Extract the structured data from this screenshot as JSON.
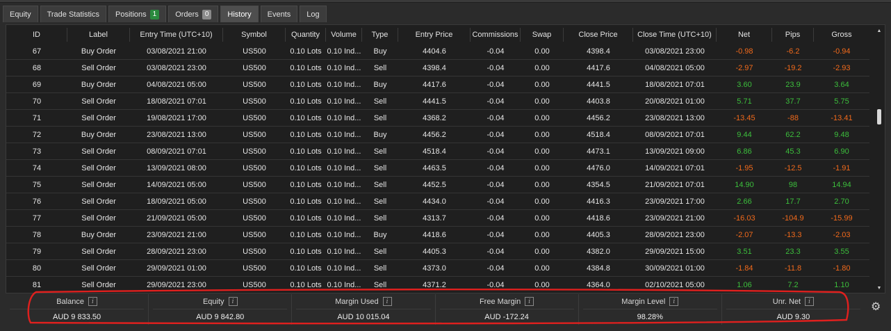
{
  "tabs": [
    {
      "label": "Equity"
    },
    {
      "label": "Trade Statistics"
    },
    {
      "label": "Positions",
      "badge": "1"
    },
    {
      "label": "Orders",
      "badge": "0"
    },
    {
      "label": "History",
      "active": true
    },
    {
      "label": "Events"
    },
    {
      "label": "Log"
    }
  ],
  "table": {
    "columns": [
      "ID",
      "Label",
      "Entry Time (UTC+10)",
      "Symbol",
      "Quantity",
      "Volume",
      "Type",
      "Entry Price",
      "Commissions",
      "Swap",
      "Close Price",
      "Close Time (UTC+10)",
      "Net",
      "Pips",
      "Gross"
    ],
    "rows": [
      [
        "67",
        "Buy Order",
        "03/08/2021 21:00",
        "US500",
        "0.10 Lots",
        "0.10 Ind...",
        "Buy",
        "4404.6",
        "-0.04",
        "0.00",
        "4398.4",
        "03/08/2021 23:00",
        "-0.98",
        "-6.2",
        "-0.94"
      ],
      [
        "68",
        "Sell Order",
        "03/08/2021 23:00",
        "US500",
        "0.10 Lots",
        "0.10 Ind...",
        "Sell",
        "4398.4",
        "-0.04",
        "0.00",
        "4417.6",
        "04/08/2021 05:00",
        "-2.97",
        "-19.2",
        "-2.93"
      ],
      [
        "69",
        "Buy Order",
        "04/08/2021 05:00",
        "US500",
        "0.10 Lots",
        "0.10 Ind...",
        "Buy",
        "4417.6",
        "-0.04",
        "0.00",
        "4441.5",
        "18/08/2021 07:01",
        "3.60",
        "23.9",
        "3.64"
      ],
      [
        "70",
        "Sell Order",
        "18/08/2021 07:01",
        "US500",
        "0.10 Lots",
        "0.10 Ind...",
        "Sell",
        "4441.5",
        "-0.04",
        "0.00",
        "4403.8",
        "20/08/2021 01:00",
        "5.71",
        "37.7",
        "5.75"
      ],
      [
        "71",
        "Sell Order",
        "19/08/2021 17:00",
        "US500",
        "0.10 Lots",
        "0.10 Ind...",
        "Sell",
        "4368.2",
        "-0.04",
        "0.00",
        "4456.2",
        "23/08/2021 13:00",
        "-13.45",
        "-88",
        "-13.41"
      ],
      [
        "72",
        "Buy Order",
        "23/08/2021 13:00",
        "US500",
        "0.10 Lots",
        "0.10 Ind...",
        "Buy",
        "4456.2",
        "-0.04",
        "0.00",
        "4518.4",
        "08/09/2021 07:01",
        "9.44",
        "62.2",
        "9.48"
      ],
      [
        "73",
        "Sell Order",
        "08/09/2021 07:01",
        "US500",
        "0.10 Lots",
        "0.10 Ind...",
        "Sell",
        "4518.4",
        "-0.04",
        "0.00",
        "4473.1",
        "13/09/2021 09:00",
        "6.86",
        "45.3",
        "6.90"
      ],
      [
        "74",
        "Sell Order",
        "13/09/2021 08:00",
        "US500",
        "0.10 Lots",
        "0.10 Ind...",
        "Sell",
        "4463.5",
        "-0.04",
        "0.00",
        "4476.0",
        "14/09/2021 07:01",
        "-1.95",
        "-12.5",
        "-1.91"
      ],
      [
        "75",
        "Sell Order",
        "14/09/2021 05:00",
        "US500",
        "0.10 Lots",
        "0.10 Ind...",
        "Sell",
        "4452.5",
        "-0.04",
        "0.00",
        "4354.5",
        "21/09/2021 07:01",
        "14.90",
        "98",
        "14.94"
      ],
      [
        "76",
        "Sell Order",
        "18/09/2021 05:00",
        "US500",
        "0.10 Lots",
        "0.10 Ind...",
        "Sell",
        "4434.0",
        "-0.04",
        "0.00",
        "4416.3",
        "23/09/2021 17:00",
        "2.66",
        "17.7",
        "2.70"
      ],
      [
        "77",
        "Sell Order",
        "21/09/2021 05:00",
        "US500",
        "0.10 Lots",
        "0.10 Ind...",
        "Sell",
        "4313.7",
        "-0.04",
        "0.00",
        "4418.6",
        "23/09/2021 21:00",
        "-16.03",
        "-104.9",
        "-15.99"
      ],
      [
        "78",
        "Buy Order",
        "23/09/2021 21:00",
        "US500",
        "0.10 Lots",
        "0.10 Ind...",
        "Buy",
        "4418.6",
        "-0.04",
        "0.00",
        "4405.3",
        "28/09/2021 23:00",
        "-2.07",
        "-13.3",
        "-2.03"
      ],
      [
        "79",
        "Sell Order",
        "28/09/2021 23:00",
        "US500",
        "0.10 Lots",
        "0.10 Ind...",
        "Sell",
        "4405.3",
        "-0.04",
        "0.00",
        "4382.0",
        "29/09/2021 15:00",
        "3.51",
        "23.3",
        "3.55"
      ],
      [
        "80",
        "Sell Order",
        "29/09/2021 01:00",
        "US500",
        "0.10 Lots",
        "0.10 Ind...",
        "Sell",
        "4373.0",
        "-0.04",
        "0.00",
        "4384.8",
        "30/09/2021 01:00",
        "-1.84",
        "-11.8",
        "-1.80"
      ],
      [
        "81",
        "Sell Order",
        "29/09/2021 23:00",
        "US500",
        "0.10 Lots",
        "0.10 Ind...",
        "Sell",
        "4371.2",
        "-0.04",
        "0.00",
        "4364.0",
        "02/10/2021 05:00",
        "1.06",
        "7.2",
        "1.10"
      ]
    ]
  },
  "summary": [
    {
      "label": "Balance",
      "value": "AUD 9 833.50"
    },
    {
      "label": "Equity",
      "value": "AUD 9 842.80"
    },
    {
      "label": "Margin Used",
      "value": "AUD 10 015.04"
    },
    {
      "label": "Free Margin",
      "value": "AUD -172.24"
    },
    {
      "label": "Margin Level",
      "value": "98.28%"
    },
    {
      "label": "Unr. Net",
      "value": "AUD 9.30"
    }
  ],
  "info_glyph": "i",
  "gear_glyph": "⚙",
  "colors": {
    "positive": "#3cbf3c",
    "negative": "#f26a1b",
    "annotation": "#e0201e",
    "badge_green": "#2a8a3e"
  }
}
